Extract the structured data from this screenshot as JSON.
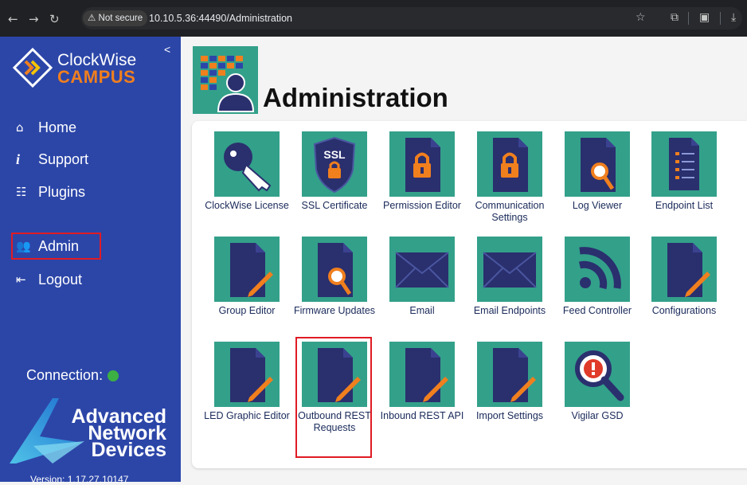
{
  "browser": {
    "not_secure": "Not secure",
    "url": "10.10.5.36:44490/Administration"
  },
  "sidebar": {
    "collapse": "<",
    "logo_line1": "ClockWise",
    "logo_line2": "CAMPUS",
    "items": [
      {
        "label": "Home",
        "icon": "home-icon"
      },
      {
        "label": "Support",
        "icon": "info-icon"
      },
      {
        "label": "Plugins",
        "icon": "plugins-icon"
      },
      {
        "label": "Admin",
        "icon": "users-icon"
      },
      {
        "label": "Logout",
        "icon": "logout-icon"
      }
    ],
    "connection_label": "Connection:",
    "connection_status_color": "#3cb043",
    "and_line1": "Advanced",
    "and_line2": "Network",
    "and_line3": "Devices",
    "version": "Version: 1.17.27.10147"
  },
  "main": {
    "title": "Administration",
    "tiles": [
      {
        "label": "ClockWise License",
        "icon": "key-icon"
      },
      {
        "label": "SSL Certificate",
        "icon": "ssl-shield-icon",
        "icon_text": "SSL"
      },
      {
        "label": "Permission Editor",
        "icon": "lock-document-icon"
      },
      {
        "label": "Communication Settings",
        "icon": "lock-document-icon"
      },
      {
        "label": "Log Viewer",
        "icon": "search-document-icon"
      },
      {
        "label": "Endpoint List",
        "icon": "list-document-icon"
      },
      {
        "label": "Group Editor",
        "icon": "edit-document-icon"
      },
      {
        "label": "Firmware Updates",
        "icon": "search-document-icon"
      },
      {
        "label": "Email",
        "icon": "envelope-icon"
      },
      {
        "label": "Email Endpoints",
        "icon": "envelope-icon"
      },
      {
        "label": "Feed Controller",
        "icon": "rss-icon"
      },
      {
        "label": "Configurations",
        "icon": "edit-document-icon"
      },
      {
        "label": "LED Graphic Editor",
        "icon": "edit-document-icon"
      },
      {
        "label": "Outbound REST Requests",
        "icon": "edit-document-icon"
      },
      {
        "label": "Inbound REST API",
        "icon": "edit-document-icon"
      },
      {
        "label": "Import Settings",
        "icon": "edit-document-icon"
      },
      {
        "label": "Vigilar GSD",
        "icon": "alert-search-icon"
      }
    ]
  },
  "colors": {
    "sidebar": "#2c46a8",
    "tile": "#33a08a",
    "doc": "#2a2f6e",
    "accent_orange": "#f07f1e",
    "highlight_red": "#e01b24"
  }
}
